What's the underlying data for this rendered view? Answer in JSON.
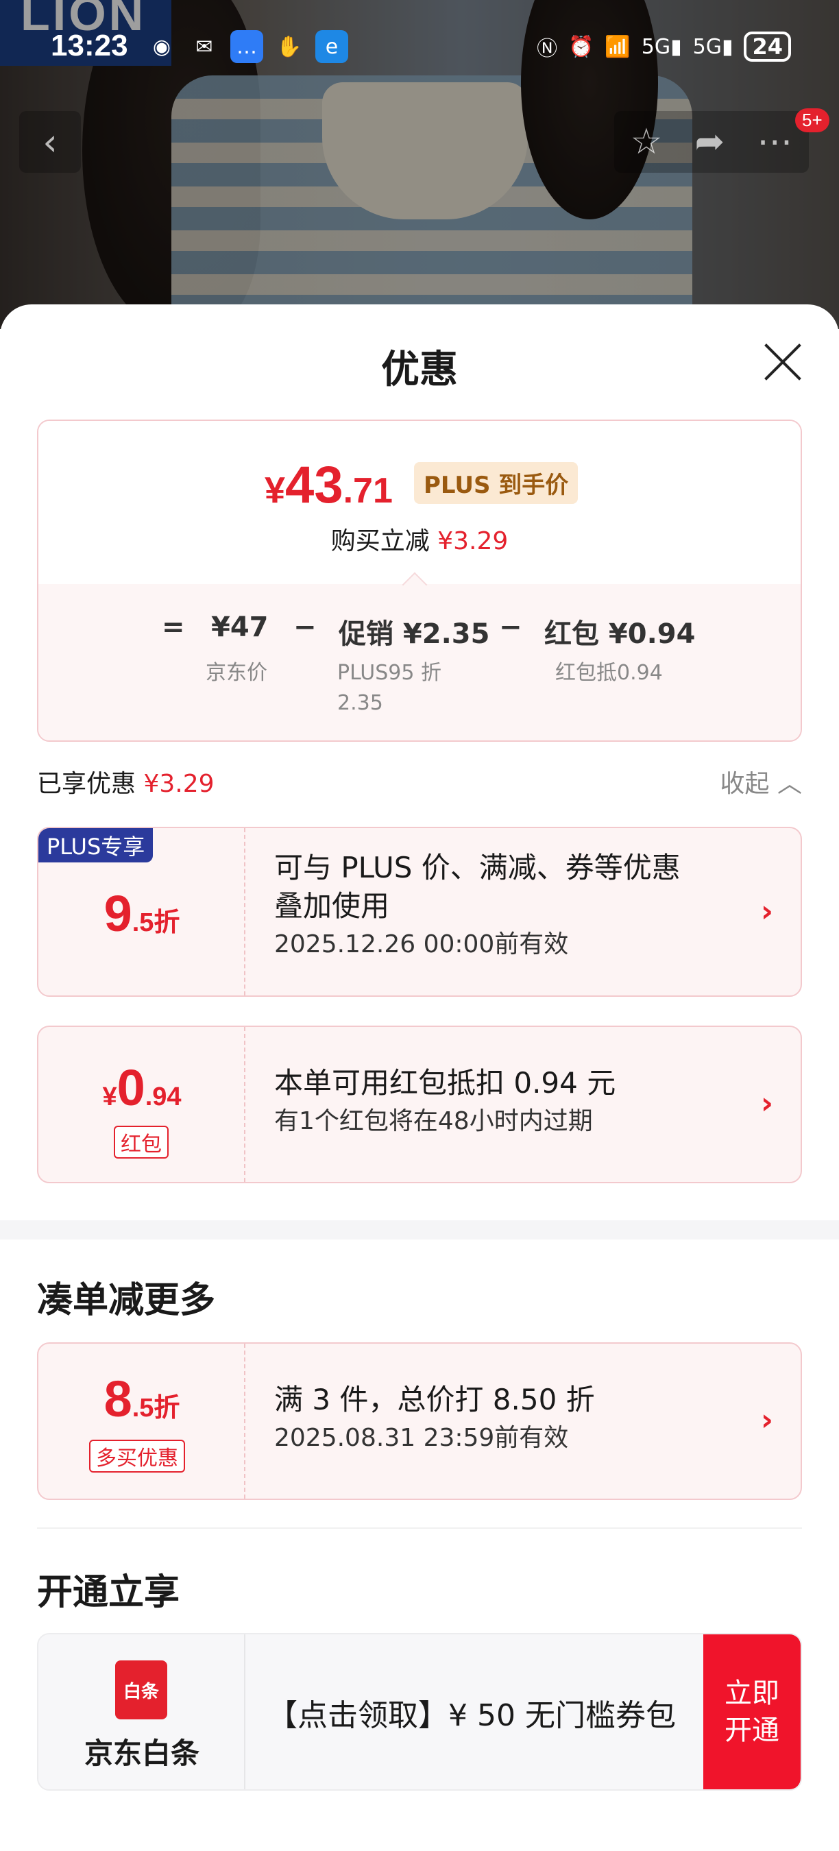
{
  "status_bar": {
    "time": "13:23",
    "battery": "24"
  },
  "background": {
    "brand_text": "LION",
    "cart_badge": "5+"
  },
  "sheet": {
    "title": "优惠",
    "price_summary": {
      "currency": "¥",
      "final_int": "43",
      "final_dec": ".71",
      "plus_tag": "PLUS 到手价",
      "save_label": "购买立减",
      "save_amount": "¥3.29",
      "formula": {
        "eq": "=",
        "jd_price": "¥47",
        "jd_price_label": "京东价",
        "minus1": "−",
        "promo": "促销 ¥2.35",
        "promo_label_1": "PLUS95 折",
        "promo_label_2": "2.35",
        "minus2": "−",
        "redpacket": "红包 ¥0.94",
        "redpacket_label": "红包抵0.94"
      }
    },
    "enjoyed": {
      "label": "已享优惠",
      "amount": "¥3.29",
      "collapse": "收起"
    },
    "coupons": [
      {
        "badge": "PLUS专享",
        "big": "9",
        "small": ".5折",
        "line1": "可与 PLUS 价、满减、券等优惠",
        "line2": "叠加使用",
        "line3": "2025.12.26 00:00前有效"
      },
      {
        "cur": "¥",
        "big": "0",
        "small": ".94",
        "tag": "红包",
        "line1": "本单可用红包抵扣 0.94 元",
        "line2": "有1个红包将在48小时内过期"
      }
    ],
    "more_section": {
      "title": "凑单减更多",
      "coupon": {
        "big": "8",
        "small": ".5折",
        "tag": "多买优惠",
        "line1": "满 3 件，总价打 8.50 折",
        "line2": "2025.08.31 23:59前有效"
      }
    },
    "open_section": {
      "title": "开通立享",
      "card": {
        "icon_text": "白条",
        "name": "京东白条",
        "text": "【点击领取】¥ 50 无门槛券包",
        "button": "立即开通"
      }
    }
  }
}
